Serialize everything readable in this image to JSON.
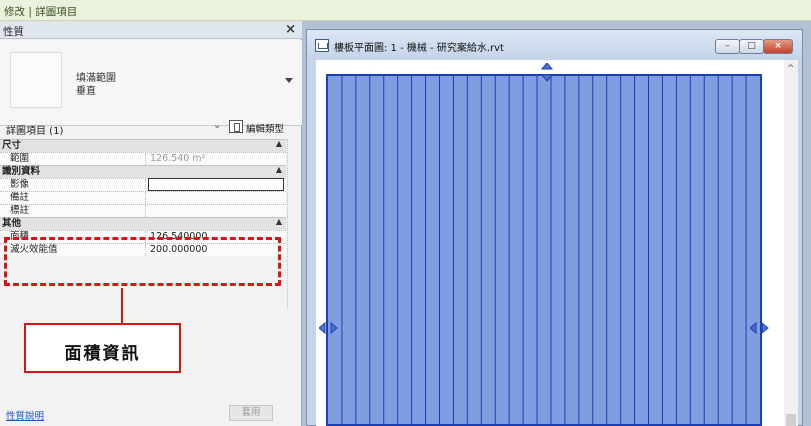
{
  "ribbon": {
    "context_label": "修改 | 詳圖項目"
  },
  "properties": {
    "title": "性質",
    "close_glyph": "×",
    "type_name_line1": "填滿範圍",
    "type_name_line2": "垂直",
    "instance_selector": "詳圖項目 (1)",
    "edit_type_label": "編輯類型",
    "groups": {
      "dimensions": {
        "label": "尺寸",
        "rows": [
          {
            "key": "範圍",
            "value": "126.540 m²"
          }
        ]
      },
      "identity": {
        "label": "識別資料",
        "rows": [
          {
            "key": "影像",
            "value": ""
          },
          {
            "key": "備註",
            "value": ""
          },
          {
            "key": "標註",
            "value": ""
          }
        ]
      },
      "other": {
        "label": "其他",
        "rows": [
          {
            "key": "面積",
            "value": "126.540000"
          },
          {
            "key": "滅火效能值",
            "value": "200.000000"
          }
        ]
      }
    },
    "help_link": "性質說明",
    "apply_button": "套用"
  },
  "callout": {
    "text": "面積資訊"
  },
  "view_window": {
    "title": "樓板平面圖: 1 - 機械 - 研究案給水.rvt",
    "stripe_count": 31
  },
  "colors": {
    "highlight": "#d81414",
    "area_fill": "#7f9ee0",
    "area_border": "#1b3fb4",
    "ribbon_bg": "#eaf2dc"
  }
}
